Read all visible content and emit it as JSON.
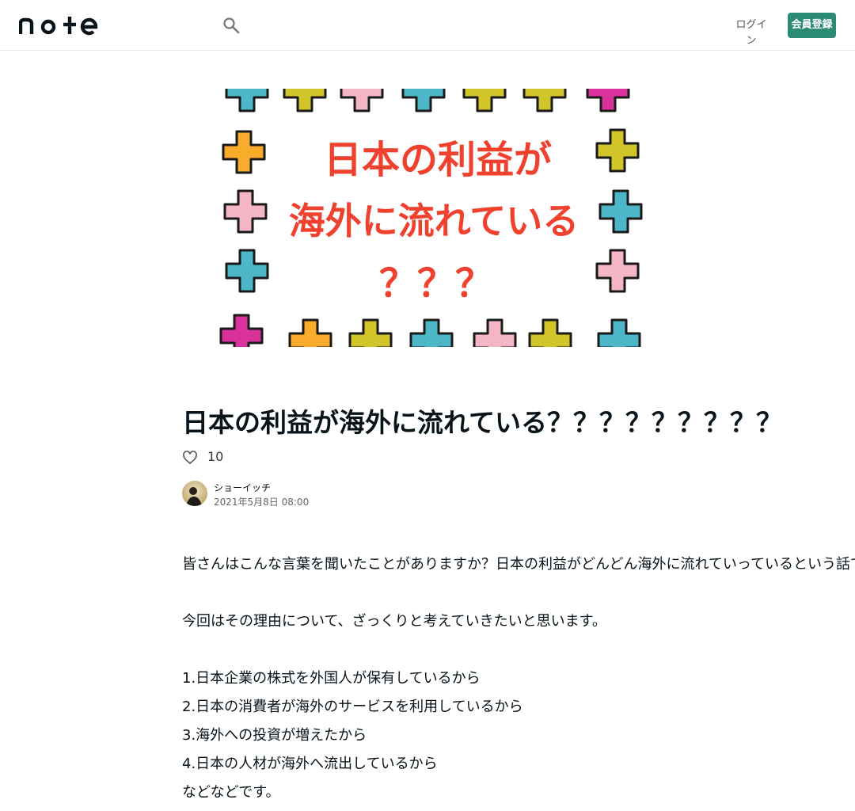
{
  "header": {
    "logo_text": "note",
    "search_icon": "search-icon",
    "login_label": "ログイン",
    "signup_label": "会員登録",
    "accent_color": "#2a8a74"
  },
  "eyecatch": {
    "lines": [
      "日本の利益が",
      "海外に流れている",
      "？？？"
    ],
    "text_color": "#f0412e",
    "decoration": "colored-cross-icons",
    "cross_colors": [
      "#ef69a8",
      "#f9ab2b",
      "#d2c52a",
      "#4db6c8",
      "#f4b5c5",
      "#d9329d"
    ]
  },
  "article": {
    "title": "日本の利益が海外に流れている？？？？？？？？？",
    "like_count": "10",
    "author_name": "ショーイッチ",
    "publish_date": "2021年5月8日 08:00",
    "paragraphs": [
      "皆さんはこんな言葉を聞いたことがありますか？日本の利益がどんどん海外に流れていっているという話です。",
      "今回はその理由について、ざっくりと考えていきたいと思います。",
      "1.日本企業の株式を外国人が保有しているから",
      "2.日本の消費者が海外のサービスを利用しているから",
      "3.海外への投資が増えたから",
      "4.日本の人材が海外へ流出しているから",
      "などなどです。"
    ]
  }
}
